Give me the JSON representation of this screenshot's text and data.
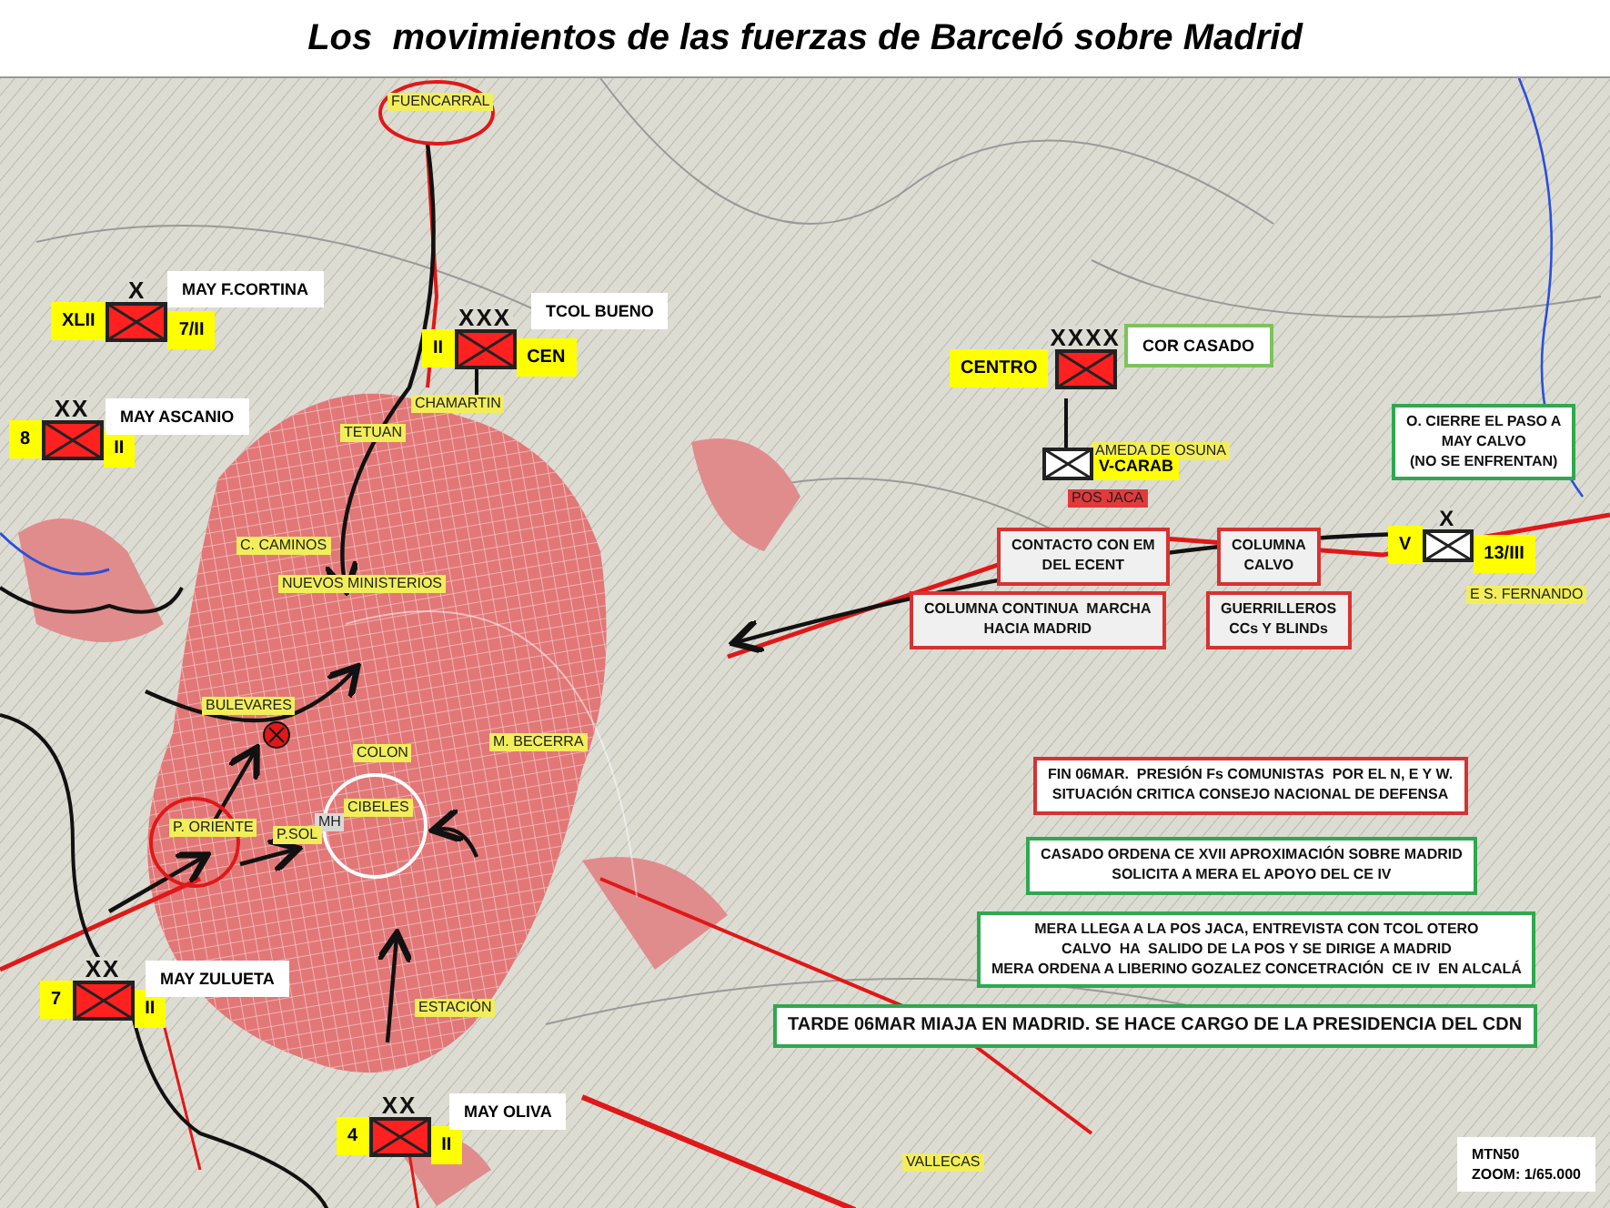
{
  "title": "Los  movimientos de las fuerzas de Barceló sobre Madrid",
  "units": [
    {
      "commander": "MAY F.CORTINA",
      "echelon": "X",
      "left_tag": "XLII",
      "right_tag": "7/II",
      "kind": "red",
      "label_outline": false
    },
    {
      "commander": "TCOL BUENO",
      "echelon": "XXX",
      "left_tag": "II",
      "right_tag": "CEN",
      "kind": "red",
      "label_outline": false
    },
    {
      "commander": "MAY ASCANIO",
      "echelon": "XX",
      "left_tag": "8",
      "right_tag": "II",
      "kind": "red",
      "label_outline": false
    },
    {
      "commander": "COR CASADO",
      "echelon": "XXXX",
      "left_tag": "CENTRO",
      "kind": "red",
      "label_outline": true
    },
    {
      "right_tag": "V-CARAB",
      "kind": "white"
    },
    {
      "echelon": "X",
      "left_tag": "V",
      "right_tag": "13/III",
      "kind": "white"
    },
    {
      "commander": "MAY ZULUETA",
      "echelon": "XX",
      "left_tag": "7",
      "right_tag": "II",
      "kind": "red",
      "label_outline": false
    },
    {
      "commander": "MAY OLIVA",
      "echelon": "XX",
      "left_tag": "4",
      "right_tag": "II",
      "kind": "red",
      "label_outline": false
    }
  ],
  "places": [
    {
      "text": "FUENCARRAL",
      "kind": "yellow"
    },
    {
      "text": "CHAMARTIN",
      "kind": "yellow"
    },
    {
      "text": "TETUAN",
      "kind": "yellow"
    },
    {
      "text": "C. CAMINOS",
      "kind": "yellow"
    },
    {
      "text": "NUEVOS MINISTERIOS",
      "kind": "yellow"
    },
    {
      "text": "BULEVARES",
      "kind": "yellow"
    },
    {
      "text": "COLON",
      "kind": "yellow"
    },
    {
      "text": "M. BECERRA",
      "kind": "yellow"
    },
    {
      "text": "CIBELES",
      "kind": "yellow"
    },
    {
      "text": "MH",
      "kind": "grey"
    },
    {
      "text": "P. ORIENTE",
      "kind": "yellow"
    },
    {
      "text": "P.SOL",
      "kind": "yellow"
    },
    {
      "text": "ESTACIÓN",
      "kind": "yellow"
    },
    {
      "text": "VALLECAS",
      "kind": "yellow"
    },
    {
      "text": "AMEDA DE OSUNA",
      "kind": "yellow"
    },
    {
      "text": "POS JACA",
      "kind": "red"
    },
    {
      "text": "E S. FERNANDO",
      "kind": "yellow"
    }
  ],
  "notes": [
    {
      "lines": [
        "O. CIERRE EL PASO A",
        "MAY CALVO",
        "(NO SE ENFRENTAN)"
      ],
      "kind": "green"
    },
    {
      "lines": [
        "CONTACTO CON EM",
        "DEL ECENT"
      ],
      "kind": "red"
    },
    {
      "lines": [
        "COLUMNA",
        "CALVO"
      ],
      "kind": "red"
    },
    {
      "lines": [
        "COLUMNA CONTINUA  MARCHA",
        "HACIA MADRID"
      ],
      "kind": "red"
    },
    {
      "lines": [
        "GUERRILLEROS",
        "CCs Y BLINDs"
      ],
      "kind": "red"
    },
    {
      "lines": [
        "FIN 06MAR.  PRESIÓN Fs COMUNISTAS  POR EL N, E Y W.",
        "SITUACIÓN CRITICA CONSEJO NACIONAL DE DEFENSA"
      ],
      "kind": "red"
    },
    {
      "lines": [
        "CASADO ORDENA CE XVII APROXIMACIÓN SOBRE MADRID",
        "SOLICITA A MERA EL APOYO DEL CE IV"
      ],
      "kind": "green"
    },
    {
      "lines": [
        "MERA LLEGA A LA POS JACA, ENTREVISTA CON TCOL OTERO",
        "CALVO  HA  SALIDO DE LA POS Y SE DIRIGE A MADRID",
        "MERA ORDENA A LIBERINO GOZALEZ CONCETRACIÓN  CE IV  EN ALCALÁ"
      ],
      "kind": "green"
    },
    {
      "lines": [
        "TARDE 06MAR MIAJA EN MADRID. SE HACE CARGO DE LA PRESIDENCIA DEL CDN"
      ],
      "kind": "green"
    }
  ],
  "scale": [
    "MTN50",
    "ZOOM: 1/65.000"
  ]
}
